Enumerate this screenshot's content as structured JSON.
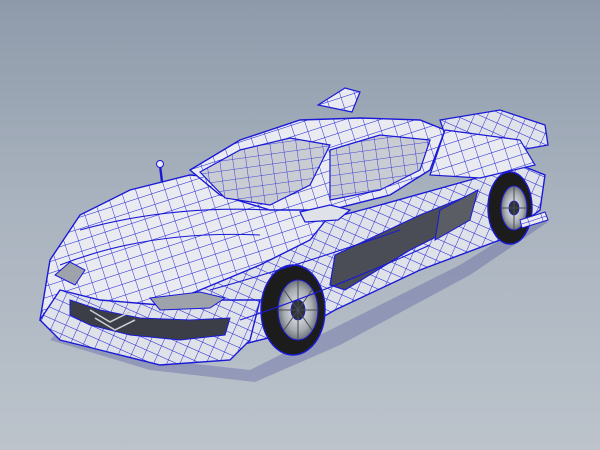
{
  "viewport": {
    "background_top": "#8e9aaa",
    "background_bottom": "#bcc3cb"
  },
  "model": {
    "subject": "sports-car",
    "display_mode": "wireframe-on-shaded",
    "wire_color": "#1a1ad6",
    "surface_color": "#e9ebf0",
    "tire_color": "#1c1c1c",
    "rim_color": "#bfc3c8"
  }
}
